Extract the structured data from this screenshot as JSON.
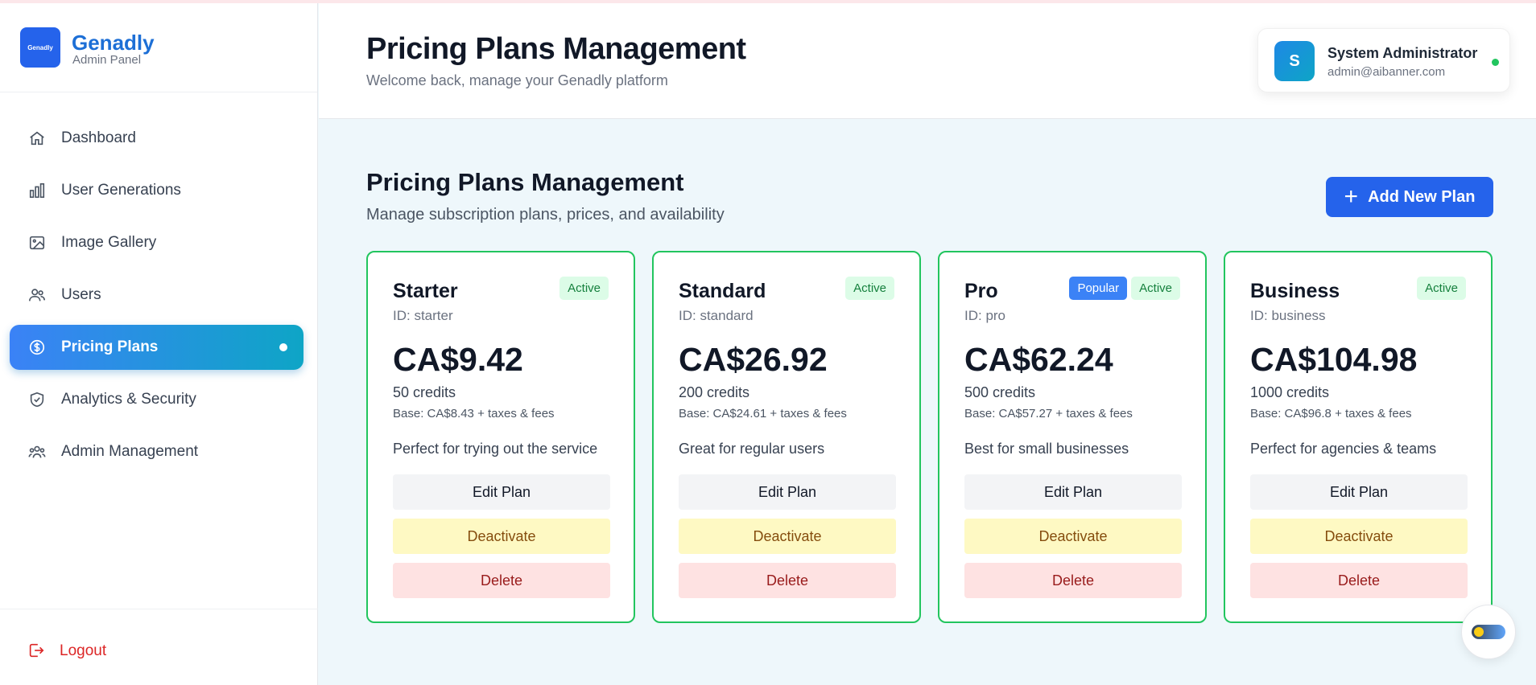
{
  "brand": {
    "logo_text": "Genadly",
    "name": "Genadly",
    "sub": "Admin Panel"
  },
  "sidebar": {
    "items": [
      {
        "label": "Dashboard",
        "icon": "home-icon"
      },
      {
        "label": "User Generations",
        "icon": "bar-chart-icon"
      },
      {
        "label": "Image Gallery",
        "icon": "image-icon"
      },
      {
        "label": "Users",
        "icon": "users-icon"
      },
      {
        "label": "Pricing Plans",
        "icon": "dollar-circle-icon",
        "active": true
      },
      {
        "label": "Analytics & Security",
        "icon": "shield-check-icon"
      },
      {
        "label": "Admin Management",
        "icon": "admin-group-icon"
      }
    ],
    "logout": "Logout"
  },
  "header": {
    "title": "Pricing Plans Management",
    "subtitle": "Welcome back, manage your Genadly platform",
    "user": {
      "initial": "S",
      "name": "System Administrator",
      "email": "admin@aibanner.com",
      "status_color": "#22c55e"
    }
  },
  "main": {
    "title": "Pricing Plans Management",
    "subtitle": "Manage subscription plans, prices, and availability",
    "add_button": "Add New Plan"
  },
  "plans": [
    {
      "name": "Starter",
      "id": "ID: starter",
      "price": "CA$9.42",
      "credits": "50 credits",
      "base": "Base: CA$8.43 + taxes & fees",
      "description": "Perfect for trying out the service",
      "popular": false,
      "status": "Active"
    },
    {
      "name": "Standard",
      "id": "ID: standard",
      "price": "CA$26.92",
      "credits": "200 credits",
      "base": "Base: CA$24.61 + taxes & fees",
      "description": "Great for regular users",
      "popular": false,
      "status": "Active"
    },
    {
      "name": "Pro",
      "id": "ID: pro",
      "price": "CA$62.24",
      "credits": "500 credits",
      "base": "Base: CA$57.27 + taxes & fees",
      "description": "Best for small businesses",
      "popular": true,
      "popular_label": "Popular",
      "status": "Active"
    },
    {
      "name": "Business",
      "id": "ID: business",
      "price": "CA$104.98",
      "credits": "1000 credits",
      "base": "Base: CA$96.8 + taxes & fees",
      "description": "Perfect for agencies & teams",
      "popular": false,
      "status": "Active"
    }
  ],
  "card_actions": {
    "edit": "Edit Plan",
    "deactivate": "Deactivate",
    "delete": "Delete"
  },
  "colors": {
    "accent": "#2563eb",
    "active_border": "#22c55e",
    "logout": "#dc2626"
  }
}
